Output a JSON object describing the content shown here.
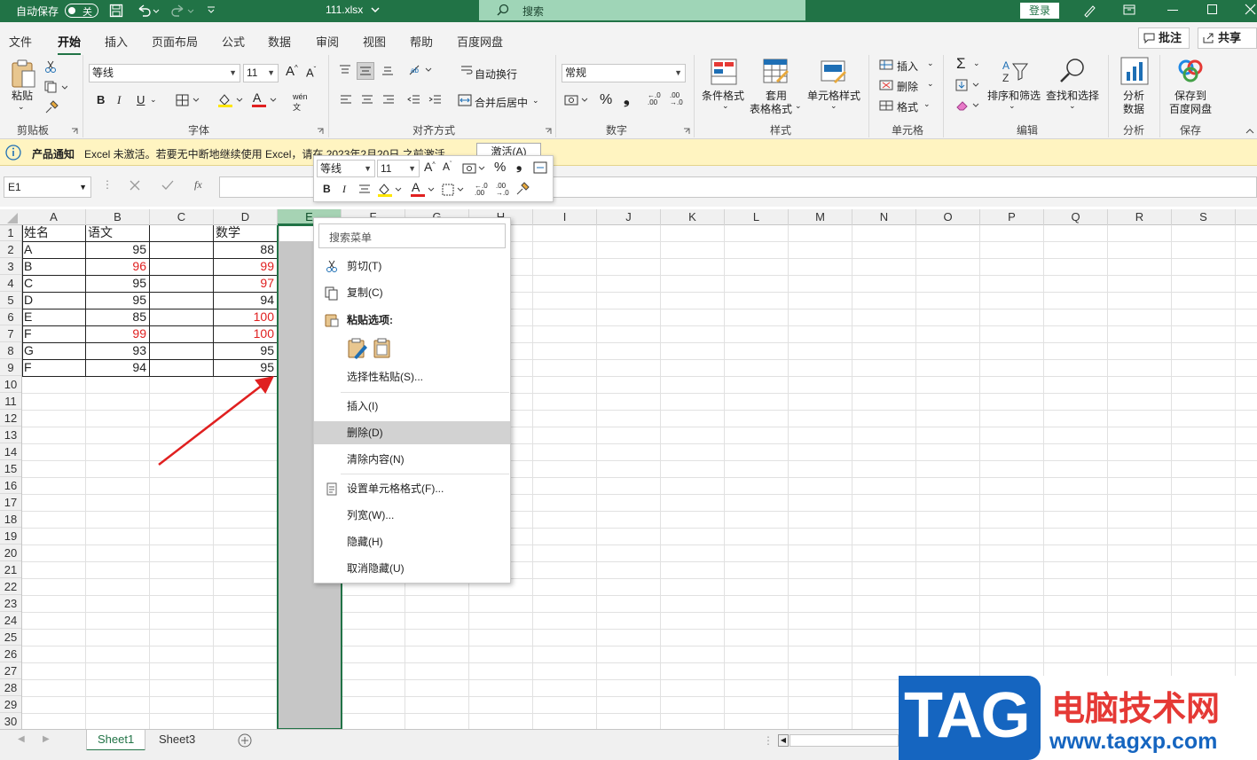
{
  "titlebar": {
    "autosave_label": "自动保存",
    "autosave_state": "关",
    "filename": "111.xlsx",
    "search_label": "搜索",
    "login_label": "登录"
  },
  "menu": {
    "tabs": [
      "文件",
      "开始",
      "插入",
      "页面布局",
      "公式",
      "数据",
      "审阅",
      "视图",
      "帮助",
      "百度网盘"
    ],
    "active_tab": "开始",
    "comment_button": "批注",
    "share_button": "共享"
  },
  "ribbon": {
    "clipboard": {
      "paste": "粘贴",
      "group": "剪贴板"
    },
    "font": {
      "name": "等线",
      "size": "11",
      "group": "字体"
    },
    "alignment": {
      "wrap": "自动换行",
      "merge": "合并后居中",
      "group": "对齐方式"
    },
    "number": {
      "format": "常规",
      "group": "数字"
    },
    "styles": {
      "conditional": "条件格式",
      "table_1": "套用",
      "table_2": "表格格式",
      "cell_style": "单元格样式",
      "group": "样式"
    },
    "cells": {
      "insert": "插入",
      "delete": "删除",
      "format": "格式",
      "group": "单元格"
    },
    "editing": {
      "sort": "排序和筛选",
      "find": "查找和选择",
      "group": "编辑"
    },
    "analysis": {
      "analyze_1": "分析",
      "analyze_2": "数据",
      "group": "分析"
    },
    "save": {
      "save_1": "保存到",
      "save_2": "百度网盘",
      "group": "保存"
    }
  },
  "notice": {
    "title": "产品通知",
    "message": "Excel 未激活。若要无中断地继续使用 Excel，请在 2023年2月20日 之前激活。",
    "button": "激活(A)"
  },
  "formula_bar": {
    "name_box": "E1",
    "fx": "fx"
  },
  "grid": {
    "columns": [
      "A",
      "B",
      "C",
      "D",
      "E",
      "F",
      "G",
      "H",
      "I",
      "J",
      "K",
      "L",
      "M",
      "N",
      "O",
      "P",
      "Q",
      "R",
      "S"
    ],
    "rows": [
      "1",
      "2",
      "3",
      "4",
      "5",
      "6",
      "7",
      "8",
      "9",
      "10",
      "11",
      "12",
      "13",
      "14",
      "15",
      "16",
      "17",
      "18",
      "19",
      "20",
      "21",
      "22",
      "23",
      "24",
      "25",
      "26",
      "27",
      "28",
      "29",
      "30"
    ],
    "data": [
      {
        "a": "姓名",
        "b": "语文",
        "d": "数学",
        "b_red": false,
        "d_red": false
      },
      {
        "a": "A",
        "b": "95",
        "d": "88",
        "b_red": false,
        "d_red": false
      },
      {
        "a": "B",
        "b": "96",
        "d": "99",
        "b_red": true,
        "d_red": true
      },
      {
        "a": "C",
        "b": "95",
        "d": "97",
        "b_red": false,
        "d_red": true
      },
      {
        "a": "D",
        "b": "95",
        "d": "94",
        "b_red": false,
        "d_red": false
      },
      {
        "a": "E",
        "b": "85",
        "d": "100",
        "b_red": false,
        "d_red": true
      },
      {
        "a": "F",
        "b": "99",
        "d": "100",
        "b_red": true,
        "d_red": true
      },
      {
        "a": "G",
        "b": "93",
        "d": "95",
        "b_red": false,
        "d_red": false
      },
      {
        "a": "F",
        "b": "94",
        "d": "95",
        "b_red": false,
        "d_red": false
      }
    ]
  },
  "mini_toolbar": {
    "font": "等线",
    "size": "11"
  },
  "context_menu": {
    "search_placeholder": "搜索菜单",
    "cut": "剪切(T)",
    "copy": "复制(C)",
    "paste_options": "粘贴选项:",
    "paste_special": "选择性粘贴(S)...",
    "insert": "插入(I)",
    "delete": "删除(D)",
    "clear": "清除内容(N)",
    "format_cells": "设置单元格格式(F)...",
    "column_width": "列宽(W)...",
    "hide": "隐藏(H)",
    "unhide": "取消隐藏(U)"
  },
  "sheets": [
    "Sheet1",
    "Sheet3"
  ],
  "active_sheet": "Sheet1",
  "watermark": {
    "tag": "TAG",
    "site_name": "电脑技术网",
    "url": "www.tagxp.com"
  },
  "colors": {
    "excel_green": "#217346",
    "red_value": "#e02020",
    "notice_bg": "#fff4c1",
    "watermark_blue": "#1565c0",
    "watermark_red": "#e53935"
  }
}
